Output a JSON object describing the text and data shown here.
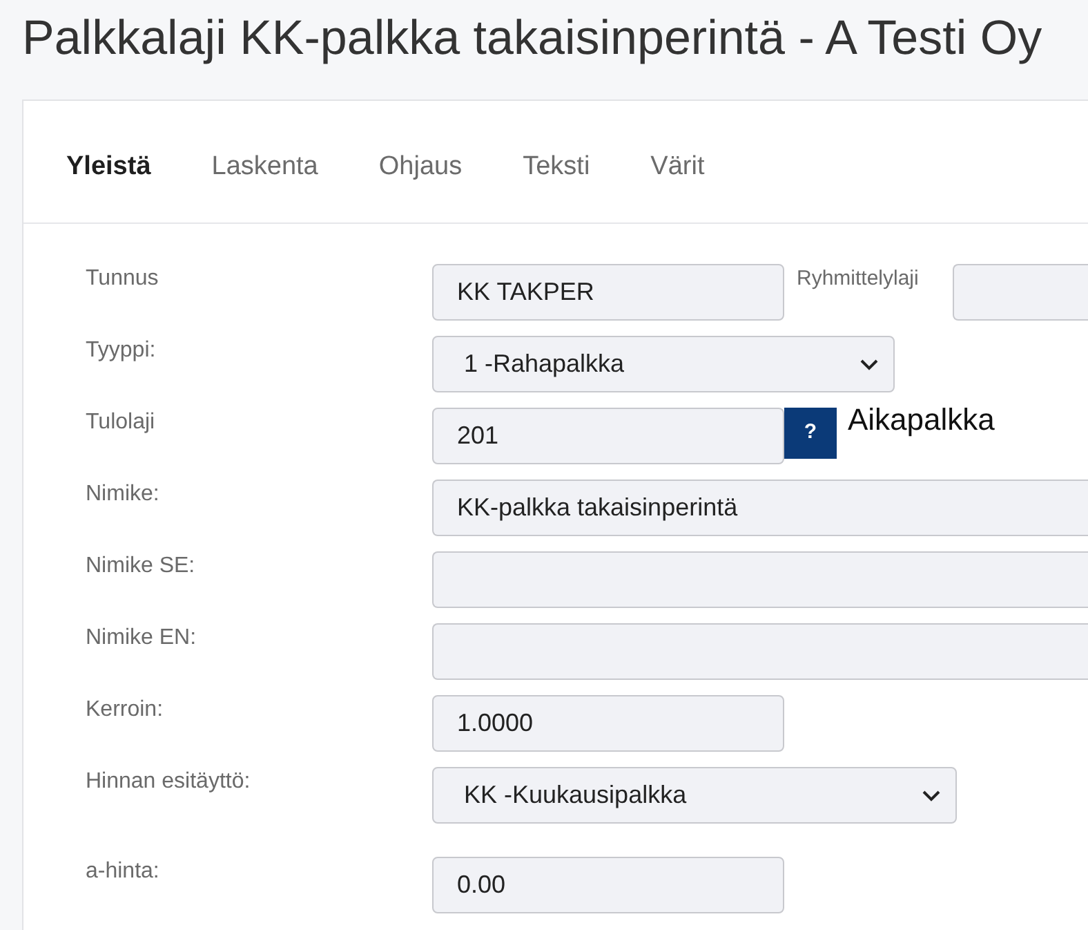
{
  "title": "Palkkalaji KK-palkka takaisinperintä - A Testi Oy",
  "tabs": [
    {
      "label": "Yleistä",
      "selected": true
    },
    {
      "label": "Laskenta",
      "selected": false
    },
    {
      "label": "Ohjaus",
      "selected": false
    },
    {
      "label": "Teksti",
      "selected": false
    },
    {
      "label": "Värit",
      "selected": false
    }
  ],
  "form": [
    {
      "kind": "text",
      "label": "Tunnus",
      "value": "KK TAKPER",
      "side_field": {
        "label": "Ryhmittelylaji"
      }
    },
    {
      "kind": "select",
      "label": "Tyyppi:",
      "value": "1 -Rahapalkka"
    },
    {
      "kind": "lookup",
      "label": "Tulolaji",
      "value": "201",
      "button": "?",
      "description": "Aikapalkka"
    },
    {
      "kind": "text-wide",
      "label": "Nimike:",
      "value": "KK-palkka takaisinperintä"
    },
    {
      "kind": "text-wide",
      "label": "Nimike SE:"
    },
    {
      "kind": "text-wide",
      "label": "Nimike EN:"
    },
    {
      "kind": "text",
      "label": "Kerroin:",
      "value": "1.0000"
    },
    {
      "kind": "select",
      "label": "Hinnan esitäyttö:",
      "value": "KK -Kuukausipalkka"
    },
    {
      "kind": "text",
      "label": "a-hinta:",
      "value": "0.00"
    }
  ]
}
